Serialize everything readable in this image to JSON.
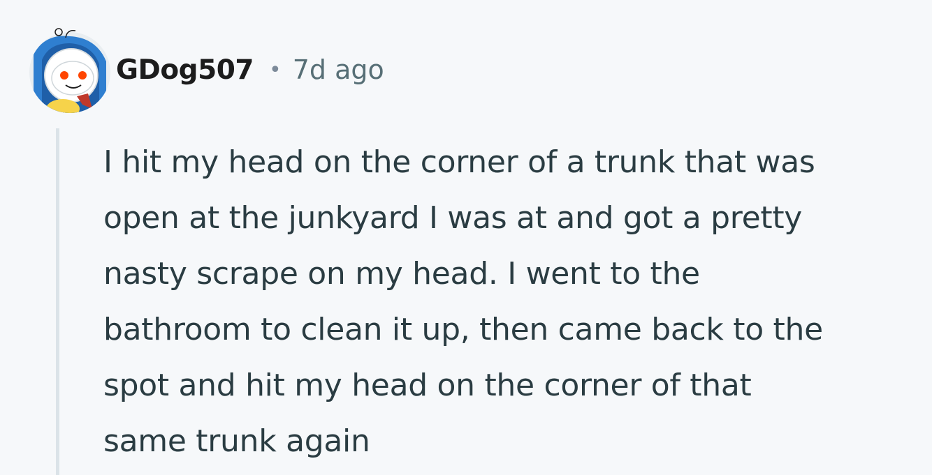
{
  "comment": {
    "author": "GDog507",
    "separator": "•",
    "timestamp": "7d ago",
    "body_lines": [
      "I hit my head on the corner of a trunk that was",
      "open at the junkyard I was at and got a pretty",
      "nasty scrape on my head. I went to the",
      "bathroom to clean it up, then came back to the",
      "spot and hit my head on the corner of that",
      "same trunk again"
    ]
  },
  "colors": {
    "background": "#f6f8fa",
    "author": "#1c1c1c",
    "timestamp": "#576f76",
    "body_text": "#2a3c42",
    "thread_line": "#dbe3e8"
  },
  "icons": {
    "avatar": "snoo-avatar-icon"
  }
}
